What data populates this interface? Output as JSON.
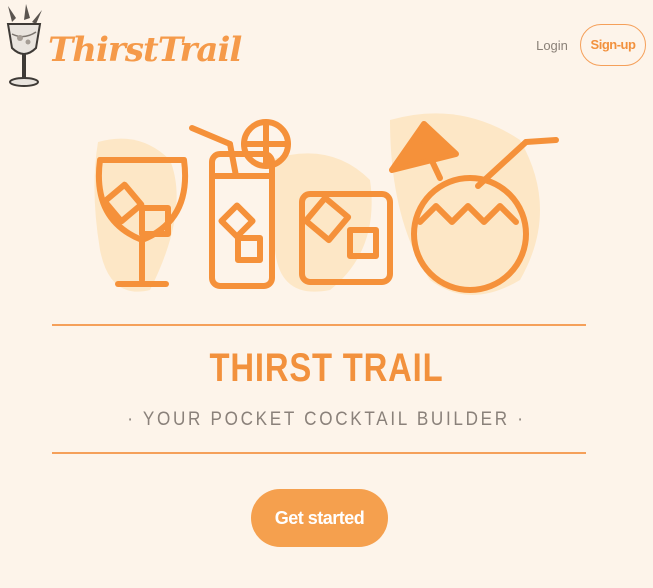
{
  "header": {
    "brand": "ThirstTrail",
    "login_label": "Login",
    "signup_label": "Sign-up"
  },
  "hero": {
    "title": "THIRST TRAIL",
    "tagline": "· YOUR POCKET COCKTAIL BUILDER ·",
    "cta_label": "Get started"
  },
  "colors": {
    "accent": "#f2913d",
    "background": "#fdf4ea",
    "blob": "#fde7c6",
    "muted_text": "#8a817a"
  },
  "icons": [
    "cocktail-shaker-logo-icon",
    "gin-glass-icon",
    "highball-glass-icon",
    "rocks-glass-icon",
    "coconut-drink-icon"
  ]
}
